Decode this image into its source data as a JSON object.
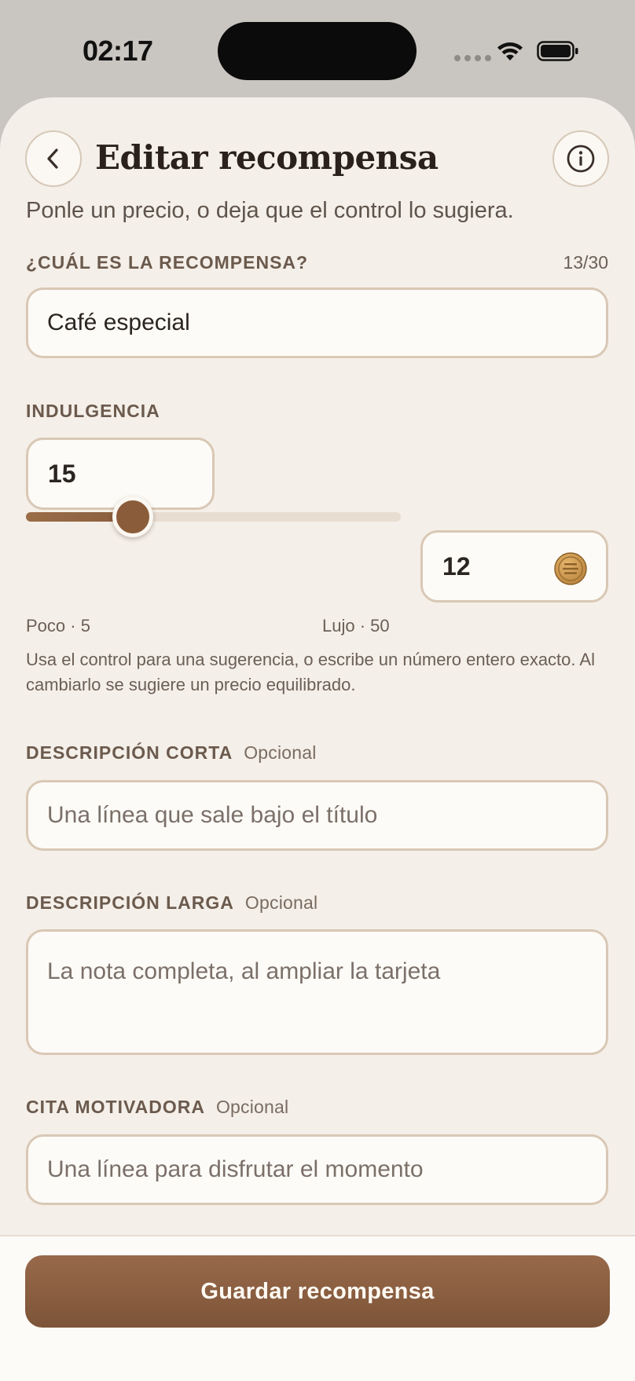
{
  "status_bar": {
    "time": "02:17"
  },
  "header": {
    "title": "Editar recompensa",
    "subtitle": "Ponle un precio, o deja que el control lo sugiera."
  },
  "reward": {
    "label": "¿CUÁL ES LA RECOMPENSA?",
    "counter": "13/30",
    "value": "Café especial"
  },
  "indulgence": {
    "label": "INDULGENCIA",
    "value": "15",
    "slider_min_label": "Poco · 5",
    "slider_max_label": "Lujo · 50",
    "slider_min": 5,
    "slider_max": 50,
    "slider_value": 15,
    "price_value": "12",
    "help_text": "Usa el control para una sugerencia, o escribe un número entero exacto. Al cambiarlo se sugiere un precio equilibrado."
  },
  "short_description": {
    "label": "DESCRIPCIÓN CORTA",
    "optional": "Opcional",
    "placeholder": "Una línea que sale bajo el título"
  },
  "long_description": {
    "label": "DESCRIPCIÓN LARGA",
    "optional": "Opcional",
    "placeholder": "La nota completa, al ampliar la tarjeta"
  },
  "quote": {
    "label": "CITA MOTIVADORA",
    "optional": "Opcional",
    "placeholder": "Una línea para disfrutar el momento"
  },
  "footer": {
    "save_label": "Guardar recompensa"
  },
  "icons": {
    "back": "chevron-left-icon",
    "info": "info-icon",
    "coin": "coin-icon",
    "wifi": "wifi-icon",
    "battery": "battery-icon",
    "signal": "cellular-signal-icon"
  },
  "colors": {
    "background": "#f4efe8",
    "accent": "#8b5c3a",
    "field_border": "#d9c8b5",
    "label": "#6b5a4d"
  }
}
